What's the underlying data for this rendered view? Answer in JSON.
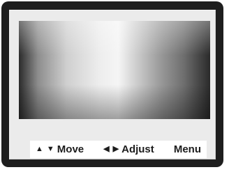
{
  "osd": {
    "move_label": "Move",
    "adjust_label": "Adjust",
    "menu_label": "Menu",
    "icons": {
      "up": "▲",
      "down": "▼",
      "left": "◀",
      "right": "▶"
    }
  },
  "colors": {
    "frame": "#1e1e1e",
    "screen_border": "#ebebeb",
    "osd_background": "#ffffff",
    "osd_text": "#1c1c1c"
  }
}
